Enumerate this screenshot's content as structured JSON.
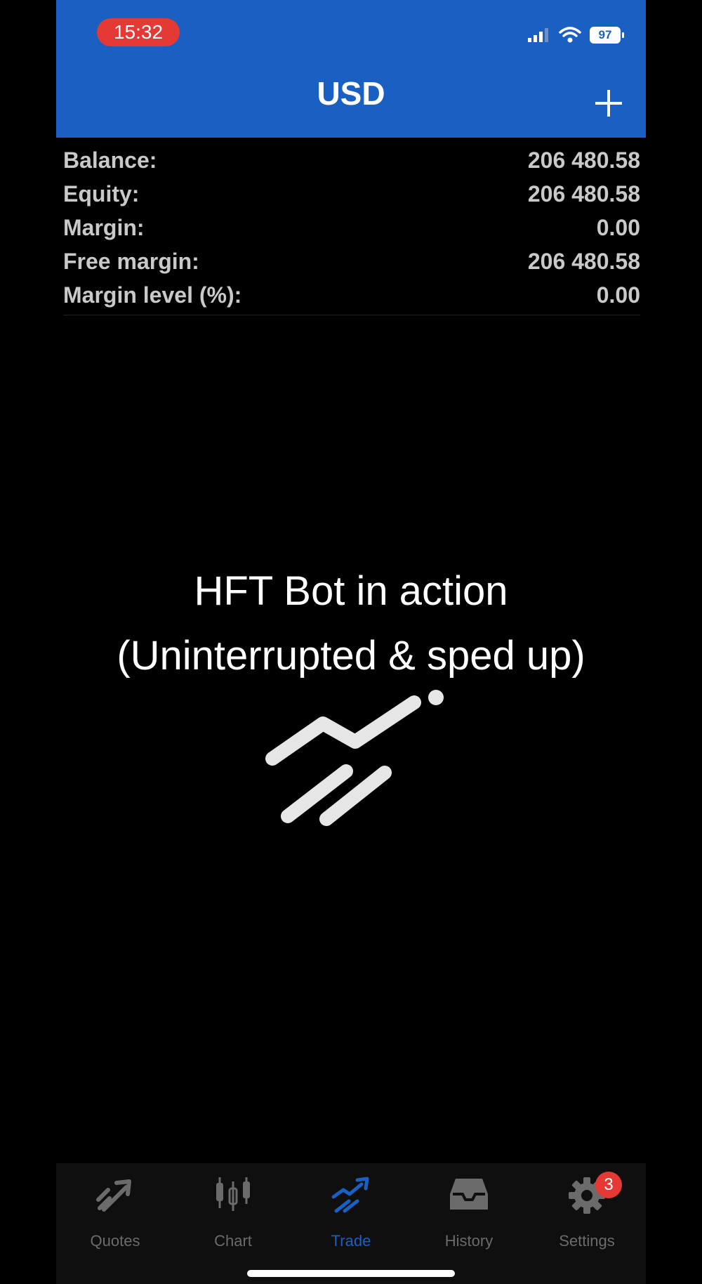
{
  "status_bar": {
    "time": "15:32",
    "battery": "97"
  },
  "header": {
    "title": "USD"
  },
  "account": {
    "rows": [
      {
        "label": "Balance:",
        "value": "206 480.58"
      },
      {
        "label": "Equity:",
        "value": "206 480.58"
      },
      {
        "label": "Margin:",
        "value": "0.00"
      },
      {
        "label": "Free margin:",
        "value": "206 480.58"
      },
      {
        "label": "Margin level (%):",
        "value": "0.00"
      }
    ]
  },
  "overlay": {
    "line1": "HFT Bot in action",
    "line2": "(Uninterrupted & sped up)"
  },
  "tabbar": {
    "tabs": [
      {
        "label": "Quotes",
        "icon": "quotes-icon"
      },
      {
        "label": "Chart",
        "icon": "candlestick-icon"
      },
      {
        "label": "Trade",
        "icon": "trade-icon",
        "active": true
      },
      {
        "label": "History",
        "icon": "inbox-icon"
      },
      {
        "label": "Settings",
        "icon": "gear-icon",
        "badge": "3"
      }
    ]
  },
  "colors": {
    "header": "#1a5fc2",
    "badge": "#e53935",
    "active_tab": "#1a5fc2"
  }
}
